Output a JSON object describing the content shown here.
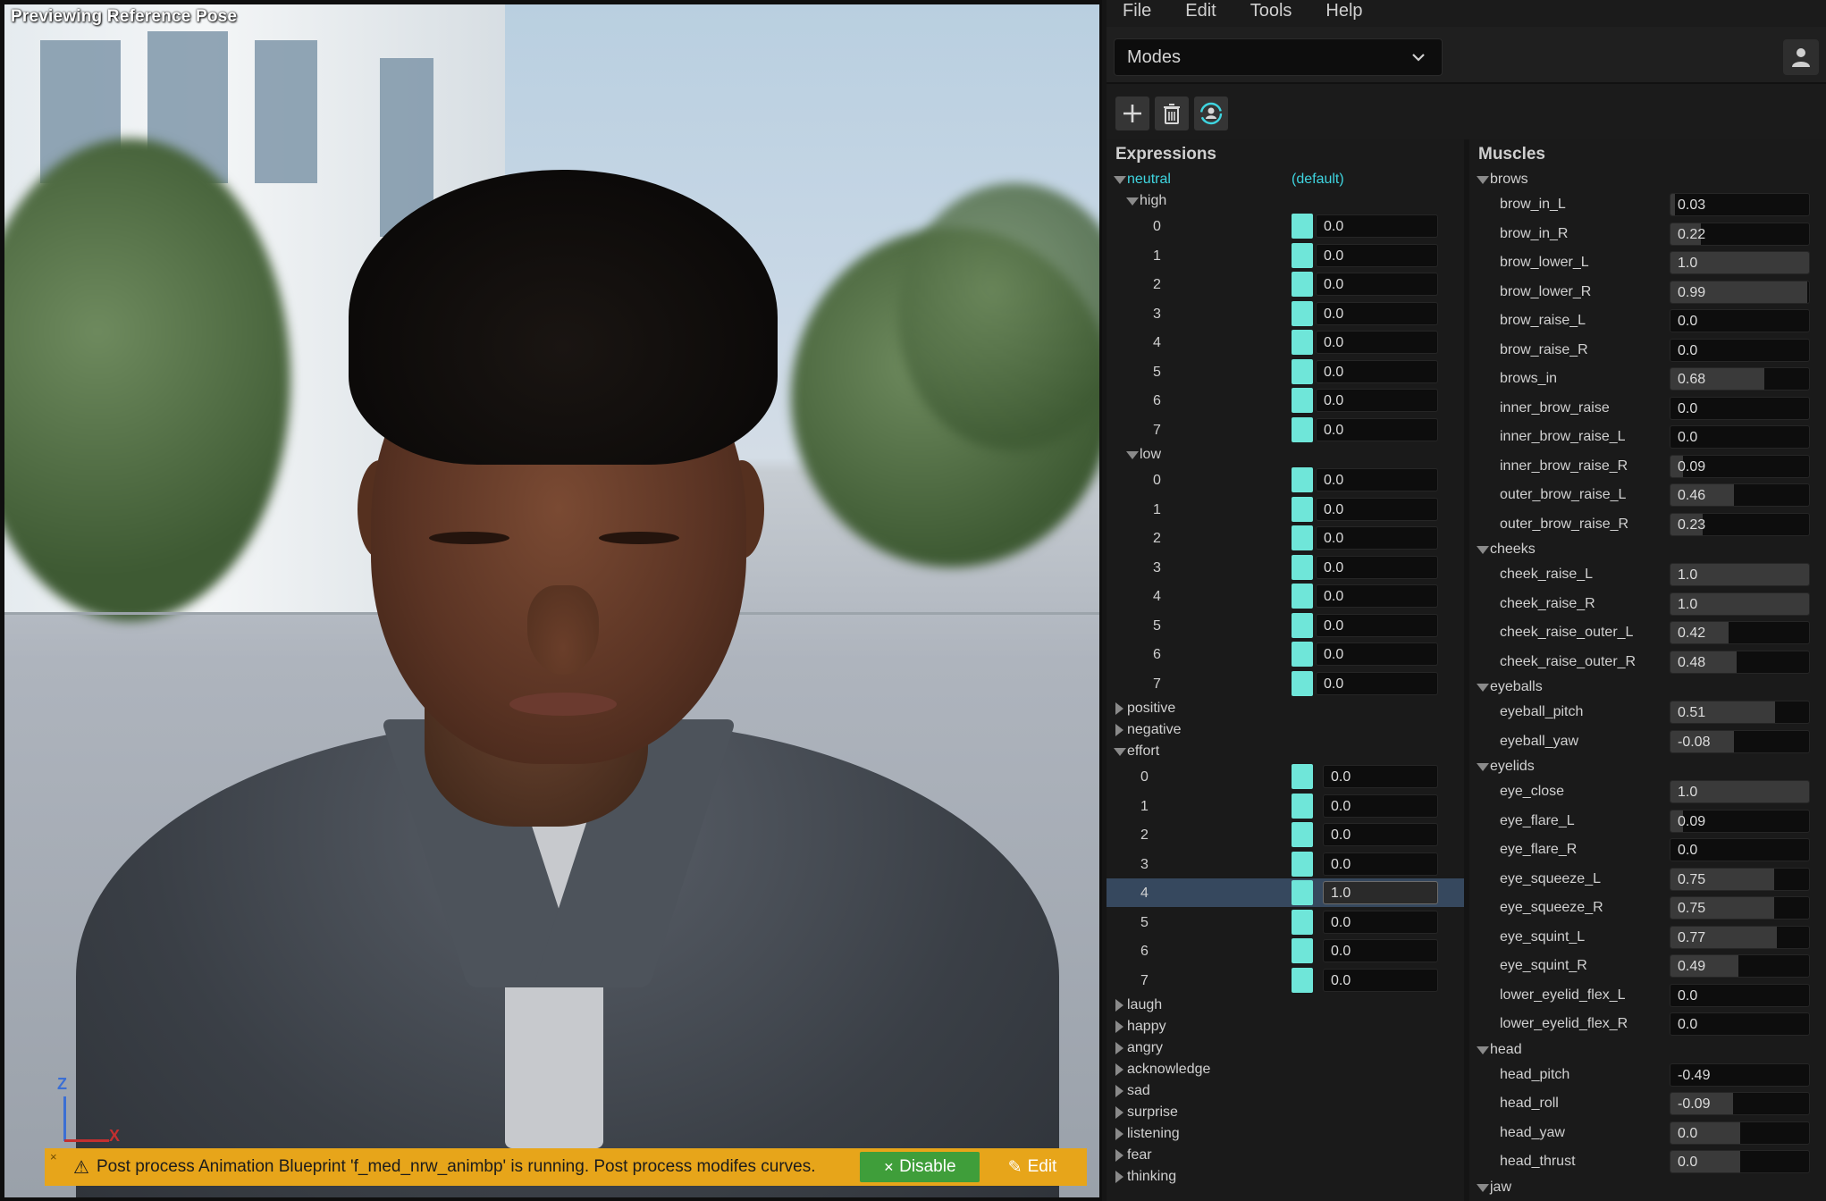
{
  "viewport": {
    "preview_label": "Previewing Reference Pose",
    "axis_z": "Z",
    "axis_x": "X",
    "warning": {
      "close": "×",
      "icon": "⚠",
      "message": "Post process Animation Blueprint 'f_med_nrw_animbp' is running. Post process modifes curves.",
      "disable_label": "Disable",
      "disable_icon": "✕",
      "edit_label": "Edit",
      "edit_icon": "✎"
    }
  },
  "menu": [
    "File",
    "Edit",
    "Tools",
    "Help"
  ],
  "modes": {
    "label": "Modes"
  },
  "colors": {
    "swatch": "#6fe6d9",
    "accent": "#3fd5e0",
    "warning": "#e7a51a",
    "disable": "#3f9e3a",
    "selected_row": "#36485e"
  },
  "expressions": {
    "title": "Expressions",
    "root": {
      "label": "neutral",
      "tag": "(default)"
    },
    "high": {
      "label": "high",
      "items": [
        {
          "i": "0",
          "v": "0.0"
        },
        {
          "i": "1",
          "v": "0.0"
        },
        {
          "i": "2",
          "v": "0.0"
        },
        {
          "i": "3",
          "v": "0.0"
        },
        {
          "i": "4",
          "v": "0.0"
        },
        {
          "i": "5",
          "v": "0.0"
        },
        {
          "i": "6",
          "v": "0.0"
        },
        {
          "i": "7",
          "v": "0.0"
        }
      ]
    },
    "low": {
      "label": "low",
      "items": [
        {
          "i": "0",
          "v": "0.0"
        },
        {
          "i": "1",
          "v": "0.0"
        },
        {
          "i": "2",
          "v": "0.0"
        },
        {
          "i": "3",
          "v": "0.0"
        },
        {
          "i": "4",
          "v": "0.0"
        },
        {
          "i": "5",
          "v": "0.0"
        },
        {
          "i": "6",
          "v": "0.0"
        },
        {
          "i": "7",
          "v": "0.0"
        }
      ]
    },
    "collapsed_a": [
      "positive",
      "negative"
    ],
    "effort": {
      "label": "effort",
      "selected_index": 4,
      "items": [
        {
          "i": "0",
          "v": "0.0"
        },
        {
          "i": "1",
          "v": "0.0"
        },
        {
          "i": "2",
          "v": "0.0"
        },
        {
          "i": "3",
          "v": "0.0"
        },
        {
          "i": "4",
          "v": "1.0"
        },
        {
          "i": "5",
          "v": "0.0"
        },
        {
          "i": "6",
          "v": "0.0"
        },
        {
          "i": "7",
          "v": "0.0"
        }
      ]
    },
    "collapsed_b": [
      "laugh",
      "happy",
      "angry",
      "acknowledge",
      "sad",
      "surprise",
      "listening",
      "fear",
      "thinking"
    ]
  },
  "muscles": {
    "title": "Muscles",
    "groups": [
      {
        "label": "brows",
        "items": [
          {
            "n": "brow_in_L",
            "v": "0.03",
            "f": 0.03
          },
          {
            "n": "brow_in_R",
            "v": "0.22",
            "f": 0.22
          },
          {
            "n": "brow_lower_L",
            "v": "1.0",
            "f": 1.0
          },
          {
            "n": "brow_lower_R",
            "v": "0.99",
            "f": 0.99
          },
          {
            "n": "brow_raise_L",
            "v": "0.0",
            "f": 0.0
          },
          {
            "n": "brow_raise_R",
            "v": "0.0",
            "f": 0.0
          },
          {
            "n": "brows_in",
            "v": "0.68",
            "f": 0.68
          },
          {
            "n": "inner_brow_raise",
            "v": "0.0",
            "f": 0.0
          },
          {
            "n": "inner_brow_raise_L",
            "v": "0.0",
            "f": 0.0
          },
          {
            "n": "inner_brow_raise_R",
            "v": "0.09",
            "f": 0.09
          },
          {
            "n": "outer_brow_raise_L",
            "v": "0.46",
            "f": 0.46
          },
          {
            "n": "outer_brow_raise_R",
            "v": "0.23",
            "f": 0.23
          }
        ]
      },
      {
        "label": "cheeks",
        "items": [
          {
            "n": "cheek_raise_L",
            "v": "1.0",
            "f": 1.0
          },
          {
            "n": "cheek_raise_R",
            "v": "1.0",
            "f": 1.0
          },
          {
            "n": "cheek_raise_outer_L",
            "v": "0.42",
            "f": 0.42
          },
          {
            "n": "cheek_raise_outer_R",
            "v": "0.48",
            "f": 0.48
          }
        ]
      },
      {
        "label": "eyeballs",
        "items": [
          {
            "n": "eyeball_pitch",
            "v": "0.51",
            "f": 0.755
          },
          {
            "n": "eyeball_yaw",
            "v": "-0.08",
            "f": 0.46
          }
        ]
      },
      {
        "label": "eyelids",
        "items": [
          {
            "n": "eye_close",
            "v": "1.0",
            "f": 1.0
          },
          {
            "n": "eye_flare_L",
            "v": "0.09",
            "f": 0.09
          },
          {
            "n": "eye_flare_R",
            "v": "0.0",
            "f": 0.0
          },
          {
            "n": "eye_squeeze_L",
            "v": "0.75",
            "f": 0.75
          },
          {
            "n": "eye_squeeze_R",
            "v": "0.75",
            "f": 0.75
          },
          {
            "n": "eye_squint_L",
            "v": "0.77",
            "f": 0.77
          },
          {
            "n": "eye_squint_R",
            "v": "0.49",
            "f": 0.49
          },
          {
            "n": "lower_eyelid_flex_L",
            "v": "0.0",
            "f": 0.0
          },
          {
            "n": "lower_eyelid_flex_R",
            "v": "0.0",
            "f": 0.0
          }
        ]
      },
      {
        "label": "head",
        "items": [
          {
            "n": "head_pitch",
            "v": "-0.49",
            "f": 0.0
          },
          {
            "n": "head_roll",
            "v": "-0.09",
            "f": 0.45
          },
          {
            "n": "head_yaw",
            "v": "0.0",
            "f": 0.5
          },
          {
            "n": "head_thrust",
            "v": "0.0",
            "f": 0.5
          }
        ]
      },
      {
        "label": "jaw",
        "items": []
      }
    ]
  }
}
